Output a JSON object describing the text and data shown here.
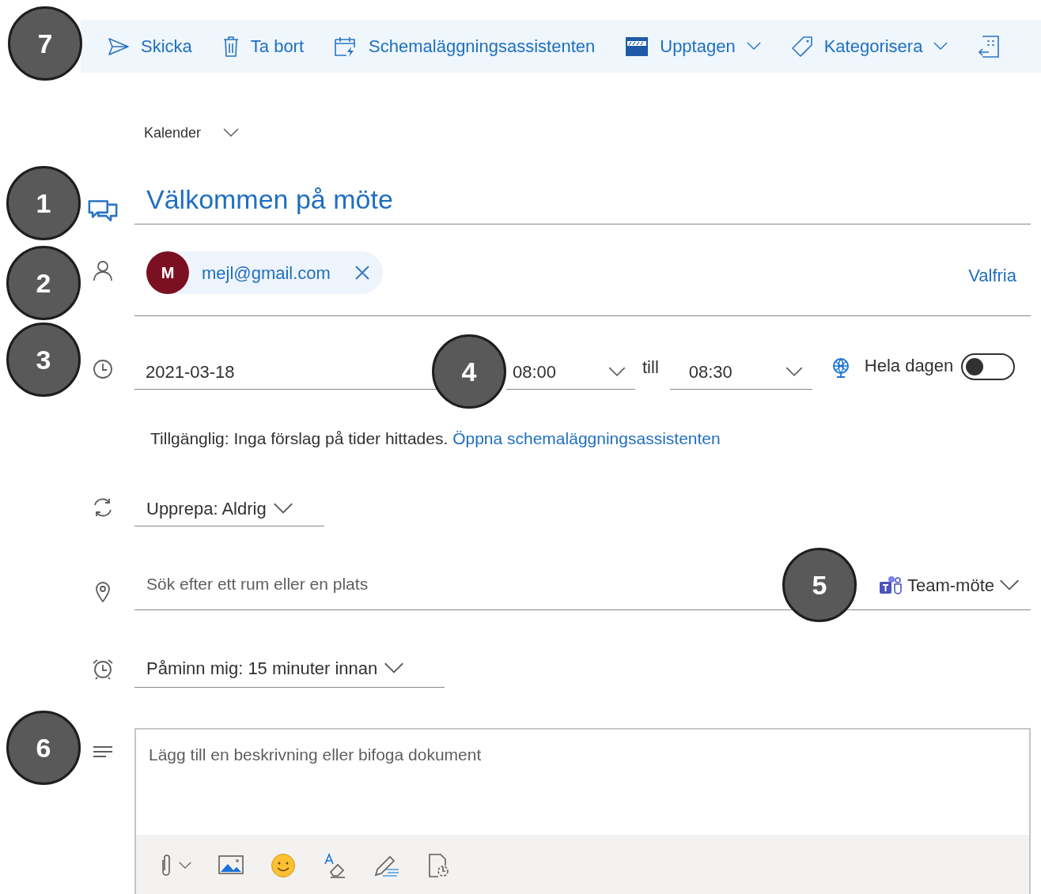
{
  "toolbar": [
    {
      "kind": "send",
      "label": "Skicka",
      "dropdown": false
    },
    {
      "kind": "delete",
      "label": "Ta bort",
      "dropdown": false
    },
    {
      "kind": "scheduler",
      "label": "Schemaläggningsassistenten",
      "dropdown": false
    },
    {
      "kind": "busy",
      "label": "Upptagen",
      "dropdown": true
    },
    {
      "kind": "tag",
      "label": "Kategorisera",
      "dropdown": true
    },
    {
      "kind": "more",
      "dropdown": false
    }
  ],
  "calendar": {
    "label": "Kalender"
  },
  "title": {
    "value": "Välkommen på möte"
  },
  "attendees": {
    "people": [
      {
        "initial": "M",
        "email": "mejl@gmail.com",
        "color": "#7a1021"
      }
    ],
    "optional_link": "Valfria"
  },
  "time": {
    "date": "2021-03-18",
    "start": "08:00",
    "separator": "till",
    "end": "08:30",
    "all_day": {
      "label": "Hela dagen",
      "on": false
    }
  },
  "availability": {
    "text": "Tillgänglig: Inga förslag på tider hittades.",
    "link": "Öppna schemaläggningsassistenten"
  },
  "repeat": {
    "label": "Upprepa:",
    "value": "Aldrig"
  },
  "location": {
    "placeholder": "Sök efter ett rum eller en plats",
    "online_meeting": "Team-möte"
  },
  "reminder": {
    "label": "Påminn mig:",
    "value": "15 minuter innan"
  },
  "description": {
    "placeholder": "Lägg till en beskrivning eller bifoga dokument",
    "tools": [
      {
        "kind": "attach"
      },
      {
        "kind": "image"
      },
      {
        "kind": "emoji"
      },
      {
        "kind": "format"
      },
      {
        "kind": "draw"
      },
      {
        "kind": "loop"
      }
    ]
  },
  "callouts": [
    {
      "label": "7"
    },
    {
      "label": "1"
    },
    {
      "label": "2"
    },
    {
      "label": "3"
    },
    {
      "label": "4"
    },
    {
      "label": "5"
    },
    {
      "label": "6"
    }
  ]
}
